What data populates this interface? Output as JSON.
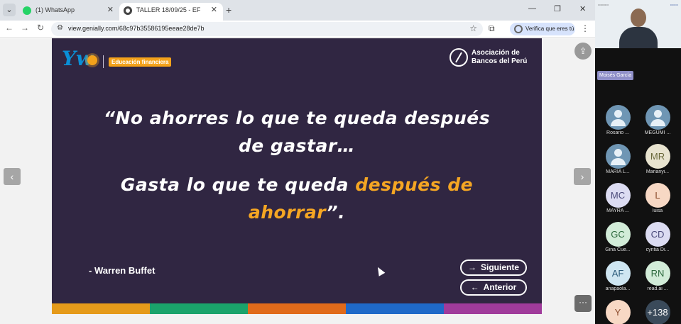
{
  "browser": {
    "tabs": [
      {
        "label": "(1) WhatsApp",
        "favicon": "whatsapp-icon",
        "color": "#25d366"
      },
      {
        "label": "TALLER 18/09/25 - EF",
        "favicon": "genially-icon",
        "color": "#444444"
      }
    ],
    "url": "view.genially.com/68c97b35586195eeae28de7b",
    "verify_label": "Verifica que eres tú"
  },
  "slide": {
    "brand_badge": "Educación financiera",
    "partner_line1": "Asociación de",
    "partner_line2": "Bancos del Perú",
    "quote_line1": "“No ahorres lo que te queda después",
    "quote_line2": "de gastar…",
    "quote_line3": "Gasta lo que te queda",
    "quote_highlight_a": "después de",
    "quote_highlight_b": "ahorrar",
    "quote_end": "”.",
    "author": "- Warren Buffet",
    "next_label": "Siguiente",
    "prev_label": "Anterior",
    "highlight_color": "#f5a623",
    "band_colors": [
      "#e59a1a",
      "#1aa36b",
      "#e06a1a",
      "#1f69c8",
      "#a03b9b"
    ]
  },
  "meeting": {
    "speaker": "Moisés García",
    "participants": [
      {
        "initials": "",
        "name": "Rosario ...",
        "photo": true
      },
      {
        "initials": "",
        "name": "MEGUMI ...",
        "photo": true
      },
      {
        "initials": "",
        "name": "MARÍA L...",
        "photo": true
      },
      {
        "initials": "MR",
        "name": "Marianyi...",
        "bg": "#e8e3cf",
        "fg": "#6b6a3c"
      },
      {
        "initials": "MC",
        "name": "MAYRA ...",
        "bg": "#dcdcf2",
        "fg": "#4a4a7a"
      },
      {
        "initials": "L",
        "name": "luisa",
        "bg": "#f7d8c4",
        "fg": "#8a4a2a"
      },
      {
        "initials": "GC",
        "name": "Gina Cue...",
        "bg": "#d2ecd8",
        "fg": "#2e6a3e"
      },
      {
        "initials": "CD",
        "name": "cyntia Di...",
        "bg": "#dcdcf2",
        "fg": "#4a4a7a"
      },
      {
        "initials": "AF",
        "name": "anapaola...",
        "bg": "#cfe6f2",
        "fg": "#2a5a7a"
      },
      {
        "initials": "RN",
        "name": "read.ai ...",
        "bg": "#d2ecd8",
        "fg": "#2e6a3e"
      },
      {
        "initials": "Y",
        "name": "",
        "bg": "#f7d8c4",
        "fg": "#8a4a2a"
      },
      {
        "initials": "+138",
        "name": "",
        "bg": "#3a4a5a",
        "fg": "#ffffff"
      }
    ]
  }
}
